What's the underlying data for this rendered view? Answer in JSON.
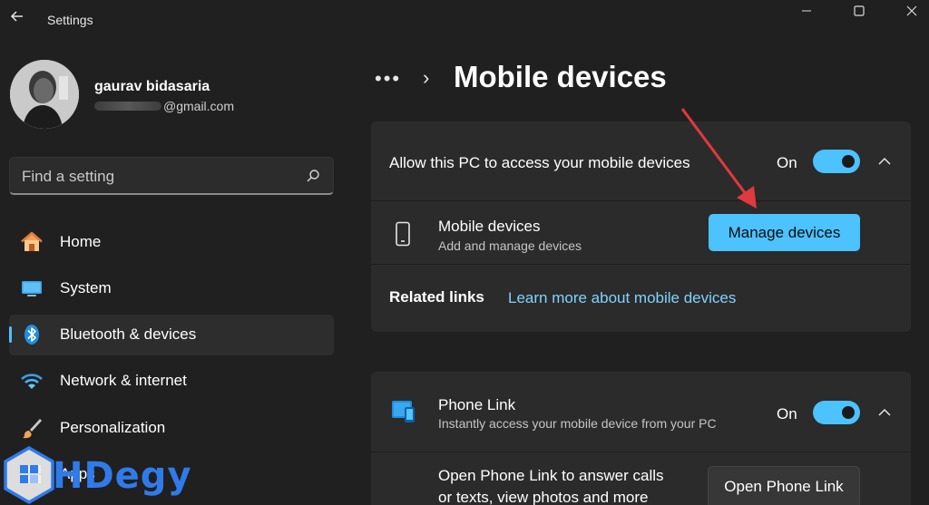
{
  "window": {
    "app_title": "Settings"
  },
  "profile": {
    "name": "gaurav bidasaria",
    "email_visible": "@gmail.com"
  },
  "search": {
    "placeholder": "Find a setting"
  },
  "nav": {
    "items": [
      {
        "label": "Home",
        "icon": "home-icon"
      },
      {
        "label": "System",
        "icon": "system-icon"
      },
      {
        "label": "Bluetooth & devices",
        "icon": "bluetooth-icon",
        "active": true
      },
      {
        "label": "Network & internet",
        "icon": "wifi-icon"
      },
      {
        "label": "Personalization",
        "icon": "brush-icon"
      },
      {
        "label": "Apps",
        "icon": "apps-icon"
      }
    ]
  },
  "breadcrumb": {
    "overflow": "•••",
    "separator": "›"
  },
  "page": {
    "title": "Mobile devices"
  },
  "mobile_card": {
    "allow_label": "Allow this PC to access your mobile devices",
    "allow_state": "On",
    "devices_title": "Mobile devices",
    "devices_sub": "Add and manage devices",
    "manage_button": "Manage devices",
    "related_label": "Related links",
    "related_link": "Learn more about mobile devices"
  },
  "phone_link_card": {
    "title": "Phone Link",
    "sub": "Instantly access your mobile device from your PC",
    "state": "On",
    "open_text_line1": "Open Phone Link to answer calls",
    "open_text_line2": "or texts, view photos and more",
    "open_button": "Open Phone Link"
  },
  "watermark": {
    "text": "HDegy"
  },
  "colors": {
    "accent": "#4cc2ff",
    "background": "#202020",
    "card": "#2b2b2b",
    "annotation_arrow": "#e0393e"
  }
}
